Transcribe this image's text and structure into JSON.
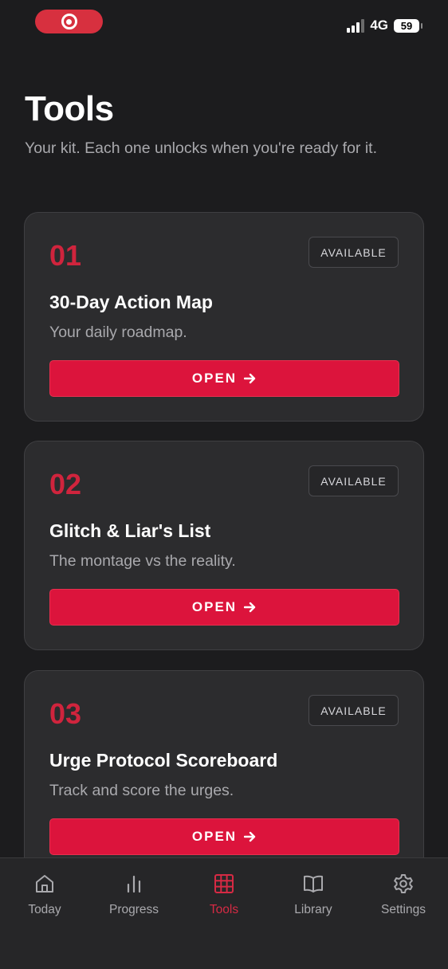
{
  "status_bar": {
    "network": "4G",
    "battery": "59"
  },
  "header": {
    "title": "Tools",
    "subtitle": "Your kit. Each one unlocks when you're ready for it."
  },
  "tools": [
    {
      "number": "01",
      "badge": "AVAILABLE",
      "title": "30-Day Action Map",
      "description": "Your daily roadmap.",
      "button": "OPEN"
    },
    {
      "number": "02",
      "badge": "AVAILABLE",
      "title": "Glitch & Liar's List",
      "description": "The montage vs the reality.",
      "button": "OPEN"
    },
    {
      "number": "03",
      "badge": "AVAILABLE",
      "title": "Urge Protocol Scoreboard",
      "description": "Track and score the urges.",
      "button": "OPEN"
    }
  ],
  "tab_bar": {
    "active": "Tools",
    "items": [
      {
        "label": "Today",
        "icon": "home-icon"
      },
      {
        "label": "Progress",
        "icon": "bar-chart-icon"
      },
      {
        "label": "Tools",
        "icon": "grid-icon"
      },
      {
        "label": "Library",
        "icon": "book-icon"
      },
      {
        "label": "Settings",
        "icon": "gear-icon"
      }
    ]
  },
  "colors": {
    "accent": "#dc143c",
    "background": "#1c1c1e",
    "card": "#2c2c2e"
  }
}
